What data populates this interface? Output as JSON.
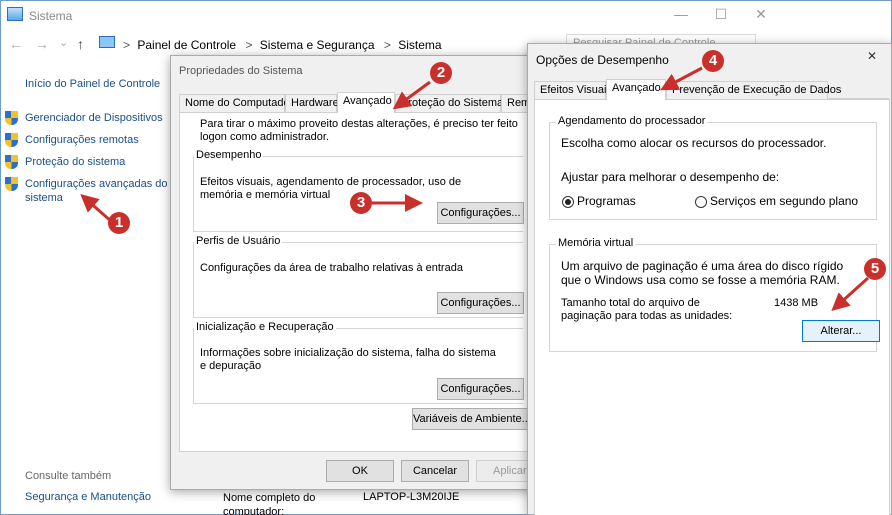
{
  "system_window": {
    "title": "Sistema",
    "controls": {
      "minimize": "—",
      "maximize": "☐",
      "close": "✕"
    },
    "nav": {
      "back": "←",
      "forward": "→",
      "dropdown": "⌄",
      "up": "↑"
    },
    "breadcrumb": [
      "Painel de Controle",
      "Sistema e Segurança",
      "Sistema"
    ],
    "breadcrumb_sep": ">",
    "search_placeholder": "Pesquisar Painel de Controle",
    "left_pane": {
      "home": "Início do Painel de Controle",
      "links": [
        "Gerenciador de Dispositivos",
        "Configurações remotas",
        "Proteção do sistema",
        "Configurações avançadas do sistema"
      ],
      "see_also": "Consulte também",
      "security": "Segurança e Manutenção"
    },
    "bottom_info": {
      "label": "Nome completo do computador:",
      "value": "LAPTOP-L3M20IJE"
    }
  },
  "system_properties": {
    "title": "Propriedades do Sistema",
    "tabs": [
      "Nome do Computador",
      "Hardware",
      "Avançado",
      "Proteção do Sistema",
      "Remo"
    ],
    "active_tab": "Avançado",
    "admin_note": "Para tirar o máximo proveito destas alterações, é preciso ter feito logon como administrador.",
    "groups": [
      {
        "title": "Desempenho",
        "desc": "Efeitos visuais, agendamento de processador, uso de memória e memória virtual",
        "button": "Configurações..."
      },
      {
        "title": "Perfis de Usuário",
        "desc": "Configurações da área de trabalho relativas à entrada",
        "button": "Configurações..."
      },
      {
        "title": "Inicialização e Recuperação",
        "desc": "Informações sobre inicialização do sistema, falha do sistema e depuração",
        "button": "Configurações..."
      }
    ],
    "env_button": "Variáveis de Ambiente...",
    "footer": {
      "ok": "OK",
      "cancel": "Cancelar",
      "apply": "Aplicar"
    }
  },
  "performance_options": {
    "title": "Opções de Desempenho",
    "close": "✕",
    "tabs": [
      "Efeitos Visuais",
      "Avançado",
      "Prevenção de Execução de Dados"
    ],
    "active_tab": "Avançado",
    "processor": {
      "title": "Agendamento do processador",
      "desc": "Escolha como alocar os recursos do processador.",
      "adjust": "Ajustar para melhorar o desempenho de:",
      "options": [
        "Programas",
        "Serviços em segundo plano"
      ],
      "selected": "Programas"
    },
    "virtual_memory": {
      "title": "Memória virtual",
      "desc": "Um arquivo de paginação é uma área do disco rígido que o Windows usa como se fosse a memória RAM.",
      "total_label": "Tamanho total do arquivo de paginação para todas as unidades:",
      "total_value": "1438 MB",
      "button": "Alterar..."
    }
  },
  "callouts": [
    "1",
    "2",
    "3",
    "4",
    "5"
  ],
  "colors": {
    "callout": "#c9302c",
    "link": "#1a4e8a",
    "focus_border": "#0078d7"
  }
}
